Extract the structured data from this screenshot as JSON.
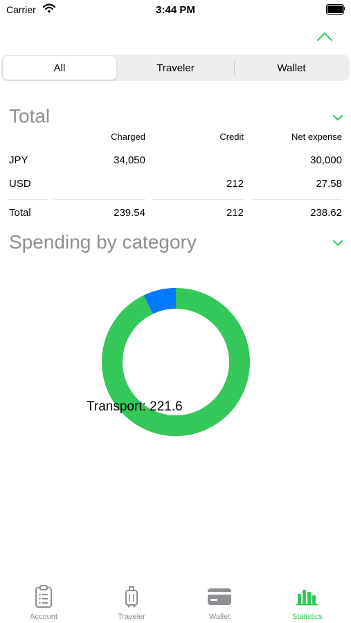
{
  "status_bar": {
    "carrier": "Carrier",
    "time": "3:44 PM"
  },
  "segments": [
    {
      "label": "All",
      "selected": true
    },
    {
      "label": "Traveler",
      "selected": false
    },
    {
      "label": "Wallet",
      "selected": false
    }
  ],
  "total_section": {
    "title": "Total",
    "columns": [
      "Charged",
      "Credit",
      "Net expense"
    ],
    "rows": [
      {
        "label": "JPY",
        "charged": "34,050",
        "credit": "",
        "net": "30,000"
      },
      {
        "label": "USD",
        "charged": "",
        "credit": "212",
        "net": "27.58"
      }
    ],
    "total": {
      "label": "Total",
      "charged": "239.54",
      "credit": "212",
      "net": "238.62"
    }
  },
  "spending_section": {
    "title": "Spending by category"
  },
  "chart_data": {
    "type": "pie",
    "style": "donut",
    "slices": [
      {
        "label": "Transport",
        "value": 221.6,
        "color": "#34c759"
      },
      {
        "label": "",
        "value": 17.0,
        "color": "#007aff"
      }
    ],
    "annotation": "Transport: 221.6"
  },
  "tabbar": {
    "items": [
      {
        "label": "Account",
        "icon": "clipboard-icon",
        "active": false
      },
      {
        "label": "Traveler",
        "icon": "luggage-icon",
        "active": false
      },
      {
        "label": "Wallet",
        "icon": "card-icon",
        "active": false
      },
      {
        "label": "Statistics",
        "icon": "bar-chart-icon",
        "active": true
      }
    ]
  },
  "colors": {
    "accent": "#34c759",
    "secondary": "#007aff",
    "muted": "#8e8e93"
  }
}
